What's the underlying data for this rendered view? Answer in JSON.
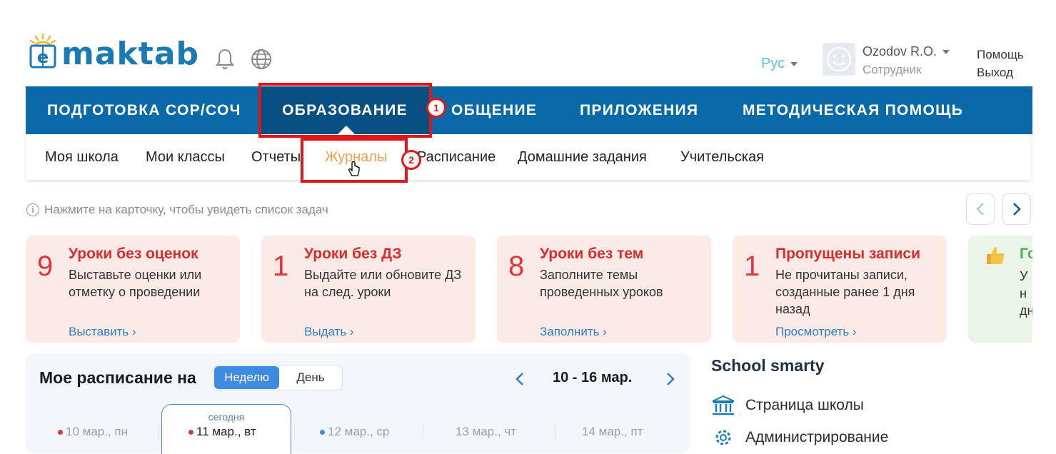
{
  "header": {
    "logo_text": "maktab",
    "language": "Рус",
    "user_name": "Ozodov R.O.",
    "user_role": "Сотрудник",
    "help": "Помощь",
    "logout": "Выход"
  },
  "nav": {
    "items": [
      "ПОДГОТОВКА СОР/СОЧ",
      "ОБРАЗОВАНИЕ",
      "ОБЩЕНИЕ",
      "ПРИЛОЖЕНИЯ",
      "МЕТОДИЧЕСКАЯ ПОМОЩЬ"
    ],
    "active": "ОБРАЗОВАНИЕ"
  },
  "subnav": {
    "items": [
      "Моя школа",
      "Мои классы",
      "Отчеты",
      "Журналы",
      "Расписание",
      "Домашние задания",
      "Учительская"
    ],
    "active": "Журналы"
  },
  "annotations": {
    "step1": "1",
    "step2": "2",
    "color": "#e0161b"
  },
  "info_hint": "Нажмите на карточку, чтобы увидеть список задач",
  "cards": [
    {
      "count": "9",
      "title": "Уроки без оценок",
      "desc": "Выставьте оценки или отметку о проведении",
      "link": "Выставить"
    },
    {
      "count": "1",
      "title": "Уроки без ДЗ",
      "desc": "Выдайте или обновите ДЗ на след. уроки",
      "link": "Выдать"
    },
    {
      "count": "8",
      "title": "Уроки без тем",
      "desc": "Заполните темы проведенных уроков",
      "link": "Заполнить"
    },
    {
      "count": "1",
      "title": "Пропущены записи",
      "desc": "Не прочитаны записи, созданные ранее 1 дня назад",
      "link": "Просмотреть"
    },
    {
      "title": "Го",
      "desc_l1": "У н",
      "desc_l2": "дн"
    }
  ],
  "schedule": {
    "title": "Мое расписание на",
    "toggle": [
      "Неделю",
      "День"
    ],
    "active_toggle": "Неделю",
    "range": "10 - 16 мар.",
    "today_label": "сегодня",
    "days": [
      {
        "label": "10 мар., пн",
        "dot": "#e0363a"
      },
      {
        "label": "11 мар., вт",
        "dot": "#e0363a"
      },
      {
        "label": "12 мар., ср",
        "dot": "#3d8ae0"
      },
      {
        "label": "13 мар., чт",
        "dot": ""
      },
      {
        "label": "14 мар., пт",
        "dot": ""
      }
    ]
  },
  "school": {
    "title": "School smarty",
    "links": [
      "Страница школы",
      "Администрирование"
    ]
  },
  "colors": {
    "nav_bg": "#0a6aa8",
    "nav_active_bg": "#075182",
    "card_bg": "#fbeae6",
    "card_accent": "#d82c2e",
    "link": "#2d7cc8",
    "subnav_active": "#f0a04b"
  }
}
